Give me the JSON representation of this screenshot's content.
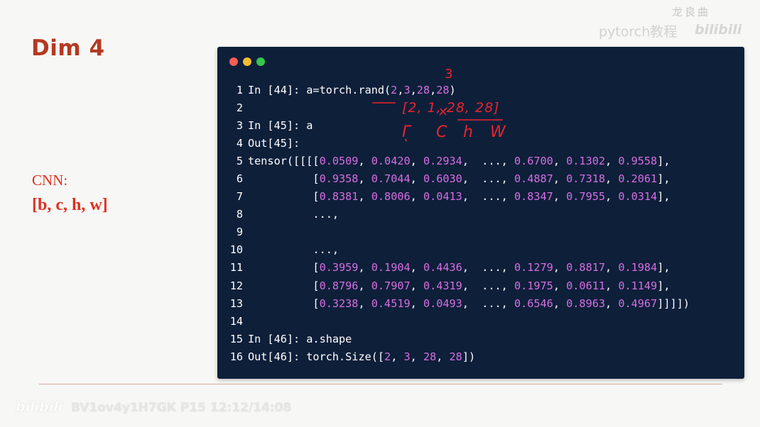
{
  "slide": {
    "title": "Dim 4",
    "cnn_label": "CNN:",
    "cnn_dims": "[b, c, h, w]"
  },
  "code_lines": [
    {
      "n": "1",
      "parts": [
        [
          "t",
          "In [44]: a=torch.rand("
        ],
        [
          "n",
          "2"
        ],
        [
          "t",
          ","
        ],
        [
          "n",
          "3"
        ],
        [
          "t",
          ","
        ],
        [
          "n",
          "28"
        ],
        [
          "t",
          ","
        ],
        [
          "n",
          "28"
        ],
        [
          "t",
          ")"
        ]
      ]
    },
    {
      "n": "2",
      "parts": []
    },
    {
      "n": "3",
      "parts": [
        [
          "t",
          "In [45]: a"
        ]
      ]
    },
    {
      "n": "4",
      "parts": [
        [
          "t",
          "Out[45]:"
        ]
      ]
    },
    {
      "n": "5",
      "parts": [
        [
          "t",
          "tensor([[[["
        ],
        [
          "n",
          "0.0509"
        ],
        [
          "t",
          ", "
        ],
        [
          "n",
          "0.0420"
        ],
        [
          "t",
          ", "
        ],
        [
          "n",
          "0.2934"
        ],
        [
          "t",
          ",  ..., "
        ],
        [
          "n",
          "0.6700"
        ],
        [
          "t",
          ", "
        ],
        [
          "n",
          "0.1302"
        ],
        [
          "t",
          ", "
        ],
        [
          "n",
          "0.9558"
        ],
        [
          "t",
          "],"
        ]
      ]
    },
    {
      "n": "6",
      "parts": [
        [
          "t",
          "          ["
        ],
        [
          "n",
          "0.9358"
        ],
        [
          "t",
          ", "
        ],
        [
          "n",
          "0.7044"
        ],
        [
          "t",
          ", "
        ],
        [
          "n",
          "0.6030"
        ],
        [
          "t",
          ",  ..., "
        ],
        [
          "n",
          "0.4887"
        ],
        [
          "t",
          ", "
        ],
        [
          "n",
          "0.7318"
        ],
        [
          "t",
          ", "
        ],
        [
          "n",
          "0.2061"
        ],
        [
          "t",
          "],"
        ]
      ]
    },
    {
      "n": "7",
      "parts": [
        [
          "t",
          "          ["
        ],
        [
          "n",
          "0.8381"
        ],
        [
          "t",
          ", "
        ],
        [
          "n",
          "0.8006"
        ],
        [
          "t",
          ", "
        ],
        [
          "n",
          "0.0413"
        ],
        [
          "t",
          ",  ..., "
        ],
        [
          "n",
          "0.8347"
        ],
        [
          "t",
          ", "
        ],
        [
          "n",
          "0.7955"
        ],
        [
          "t",
          ", "
        ],
        [
          "n",
          "0.0314"
        ],
        [
          "t",
          "],"
        ]
      ]
    },
    {
      "n": "8",
      "parts": [
        [
          "t",
          "          ...,"
        ]
      ]
    },
    {
      "n": "9",
      "parts": []
    },
    {
      "n": "10",
      "parts": [
        [
          "t",
          "          ...,"
        ]
      ]
    },
    {
      "n": "11",
      "parts": [
        [
          "t",
          "          ["
        ],
        [
          "n",
          "0.3959"
        ],
        [
          "t",
          ", "
        ],
        [
          "n",
          "0.1904"
        ],
        [
          "t",
          ", "
        ],
        [
          "n",
          "0.4436"
        ],
        [
          "t",
          ",  ..., "
        ],
        [
          "n",
          "0.1279"
        ],
        [
          "t",
          ", "
        ],
        [
          "n",
          "0.8817"
        ],
        [
          "t",
          ", "
        ],
        [
          "n",
          "0.1984"
        ],
        [
          "t",
          "],"
        ]
      ]
    },
    {
      "n": "12",
      "parts": [
        [
          "t",
          "          ["
        ],
        [
          "n",
          "0.8796"
        ],
        [
          "t",
          ", "
        ],
        [
          "n",
          "0.7907"
        ],
        [
          "t",
          ", "
        ],
        [
          "n",
          "0.4319"
        ],
        [
          "t",
          ",  ..., "
        ],
        [
          "n",
          "0.1975"
        ],
        [
          "t",
          ", "
        ],
        [
          "n",
          "0.0611"
        ],
        [
          "t",
          ", "
        ],
        [
          "n",
          "0.1149"
        ],
        [
          "t",
          "],"
        ]
      ]
    },
    {
      "n": "13",
      "parts": [
        [
          "t",
          "          ["
        ],
        [
          "n",
          "0.3238"
        ],
        [
          "t",
          ", "
        ],
        [
          "n",
          "0.4519"
        ],
        [
          "t",
          ", "
        ],
        [
          "n",
          "0.0493"
        ],
        [
          "t",
          ",  ..., "
        ],
        [
          "n",
          "0.6546"
        ],
        [
          "t",
          ", "
        ],
        [
          "n",
          "0.8963"
        ],
        [
          "t",
          ", "
        ],
        [
          "n",
          "0.4967"
        ],
        [
          "t",
          "]]]])"
        ]
      ]
    },
    {
      "n": "14",
      "parts": []
    },
    {
      "n": "15",
      "parts": [
        [
          "t",
          "In [46]: a.shape"
        ]
      ]
    },
    {
      "n": "16",
      "parts": [
        [
          "t",
          "Out[46]: torch.Size(["
        ],
        [
          "n",
          "2"
        ],
        [
          "t",
          ", "
        ],
        [
          "n",
          "3"
        ],
        [
          "t",
          ", "
        ],
        [
          "n",
          "28"
        ],
        [
          "t",
          ", "
        ],
        [
          "n",
          "28"
        ],
        [
          "t",
          "])"
        ]
      ]
    }
  ],
  "annotations": {
    "above_3": "3",
    "dims_written": "[2, 1, 28, 28]",
    "letters": [
      "Γ",
      "C",
      "h",
      "W"
    ]
  },
  "footer": {
    "logo": "bilibili",
    "meta": "BV1ov4y1H7GK P15 12:12/14:08"
  },
  "watermark": {
    "top": "龙良曲",
    "main": "pytorch教程",
    "logo": "bilibili"
  },
  "colors": {
    "title": "#b43a22",
    "cnn_text": "#e03020",
    "code_bg": "#0e1f3a",
    "code_number": "#d56fe0",
    "annotation": "#e8242c"
  }
}
